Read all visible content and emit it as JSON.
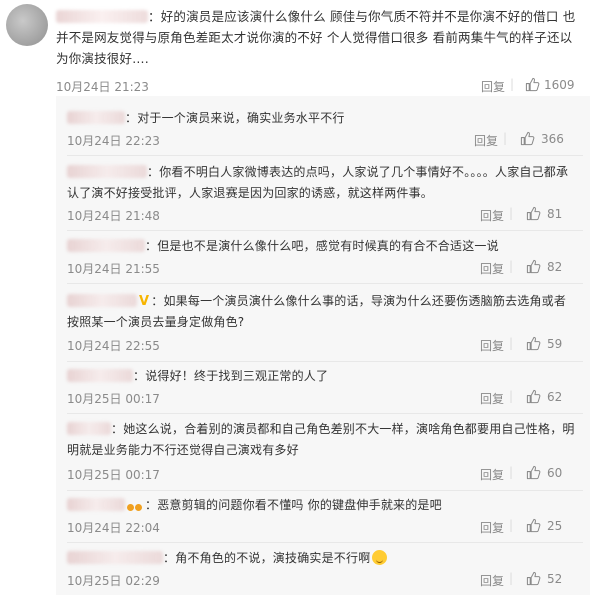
{
  "main_comment": {
    "text": "：好的演员是应该演什么像什么 顾佳与你气质不符并不是你演不好的借口 也并不是网友觉得与原角色差距太才说你演的不好 个人觉得借口很多 看前两集牛气的样子还以为你演技很好....",
    "time": "10月24日 21:23",
    "reply_label": "回复",
    "likes": "1609"
  },
  "replies": [
    {
      "text": "：对于一个演员来说，确实业务水平不行",
      "time": "10月24日 22:23",
      "reply_label": "回复",
      "likes": "366"
    },
    {
      "text": "：你看不明白人家微博表达的点吗，人家说了几个事情好不。。。。人家自己都承认了演不好接受批评，人家退赛是因为回家的诱惑，就这样两件事。",
      "time": "10月24日 21:48",
      "reply_label": "回复",
      "likes": "81"
    },
    {
      "text": "：但是也不是演什么像什么吧，感觉有时候真的有合不合适这一说",
      "time": "10月24日 21:55",
      "reply_label": "回复",
      "likes": "82"
    },
    {
      "text": "：如果每一个演员演什么像什么事的话，导演为什么还要伤透脑筋去选角或者按照某一个演员去量身定做角色?",
      "time": "10月24日 22:55",
      "reply_label": "回复",
      "likes": "59",
      "badge": "V"
    },
    {
      "text": "：说得好！终于找到三观正常的人了",
      "time": "10月25日 00:17",
      "reply_label": "回复",
      "likes": "62"
    },
    {
      "text": "：她这么说，合着别的演员都和自己角色差别不大一样，演啥角色都要用自己性格，明明就是业务能力不行还觉得自己演戏有多好",
      "time": "10月25日 00:17",
      "reply_label": "回复",
      "likes": "60"
    },
    {
      "text": "：恶意剪辑的问题你看不懂吗 你的键盘伸手就来的是吧",
      "time": "10月24日 22:04",
      "reply_label": "回复",
      "likes": "25"
    },
    {
      "text": "：角不角色的不说，演技确实是不行啊",
      "time": "10月25日 02:29",
      "reply_label": "回复",
      "likes": "52"
    }
  ],
  "icons": {
    "like": "thumbs-up-icon",
    "vip": "vip-badge-icon",
    "emoji": "emoji-icon"
  },
  "colors": {
    "meta_text": "#8a8a8a",
    "vip_badge": "#f7b500",
    "panel_bg": "#f7f7f7"
  }
}
